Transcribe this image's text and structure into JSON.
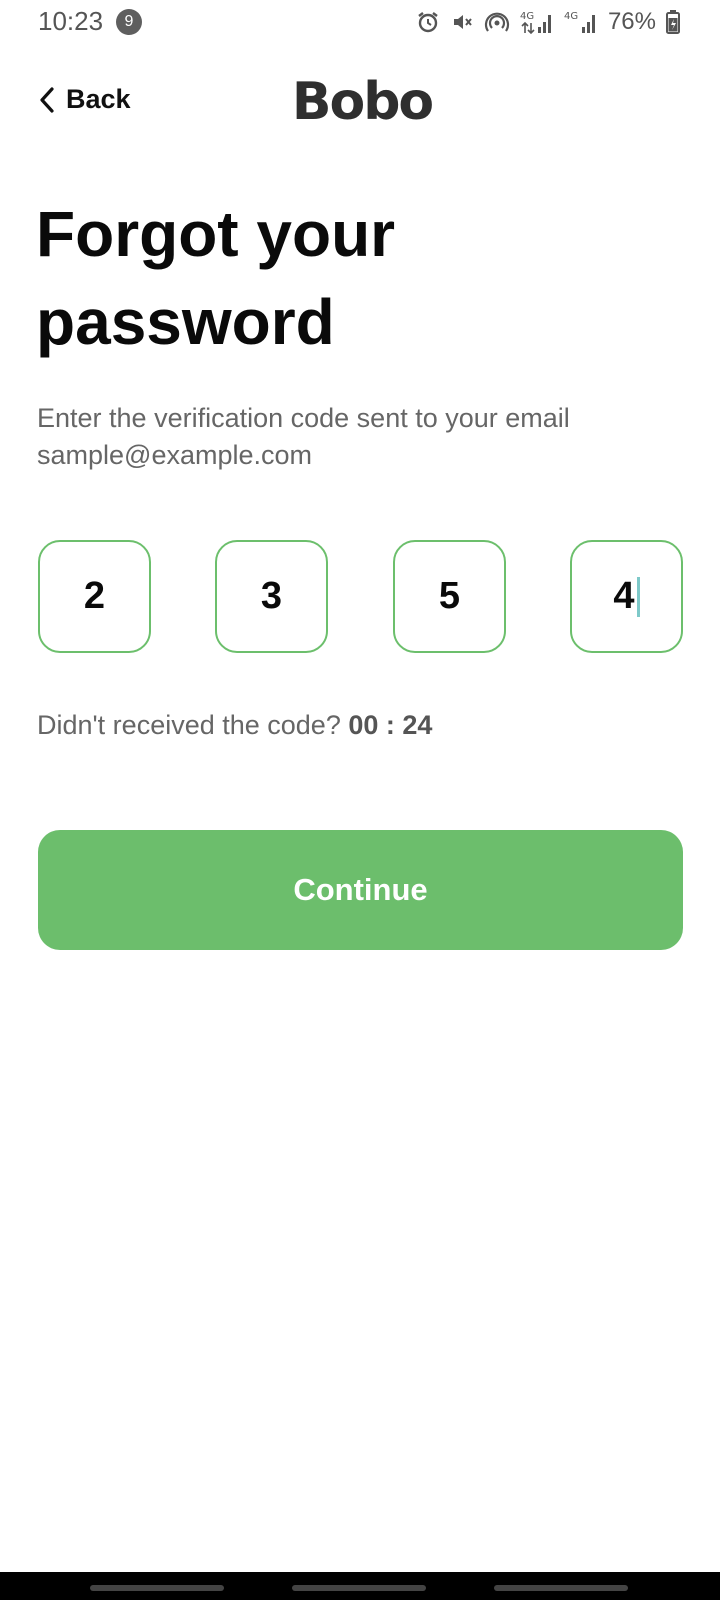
{
  "status_bar": {
    "time": "10:23",
    "notification_count": "9",
    "battery": "76%",
    "icons": [
      "alarm-icon",
      "mute-icon",
      "hotspot-icon",
      "4g-data-icon",
      "signal-icon",
      "4g-icon",
      "signal-icon",
      "battery-charging-icon"
    ],
    "network_label_1": "4G",
    "network_label_2": "4G"
  },
  "header": {
    "back_label": "Back",
    "logo_text": "Bobo"
  },
  "page": {
    "title_line1": "Forgot your",
    "title_line2": "password",
    "instruction_line1": "Enter the verification code sent to your email",
    "instruction_line2": "sample@example.com"
  },
  "otp": {
    "digits": [
      "2",
      "3",
      "5",
      "4"
    ]
  },
  "resend": {
    "prompt": "Didn't received the code?",
    "timer": "00 : 24"
  },
  "actions": {
    "continue_label": "Continue"
  },
  "colors": {
    "accent": "#6cbe6c",
    "otp_border": "#6cbf6c",
    "caret": "#7ec9c9"
  }
}
